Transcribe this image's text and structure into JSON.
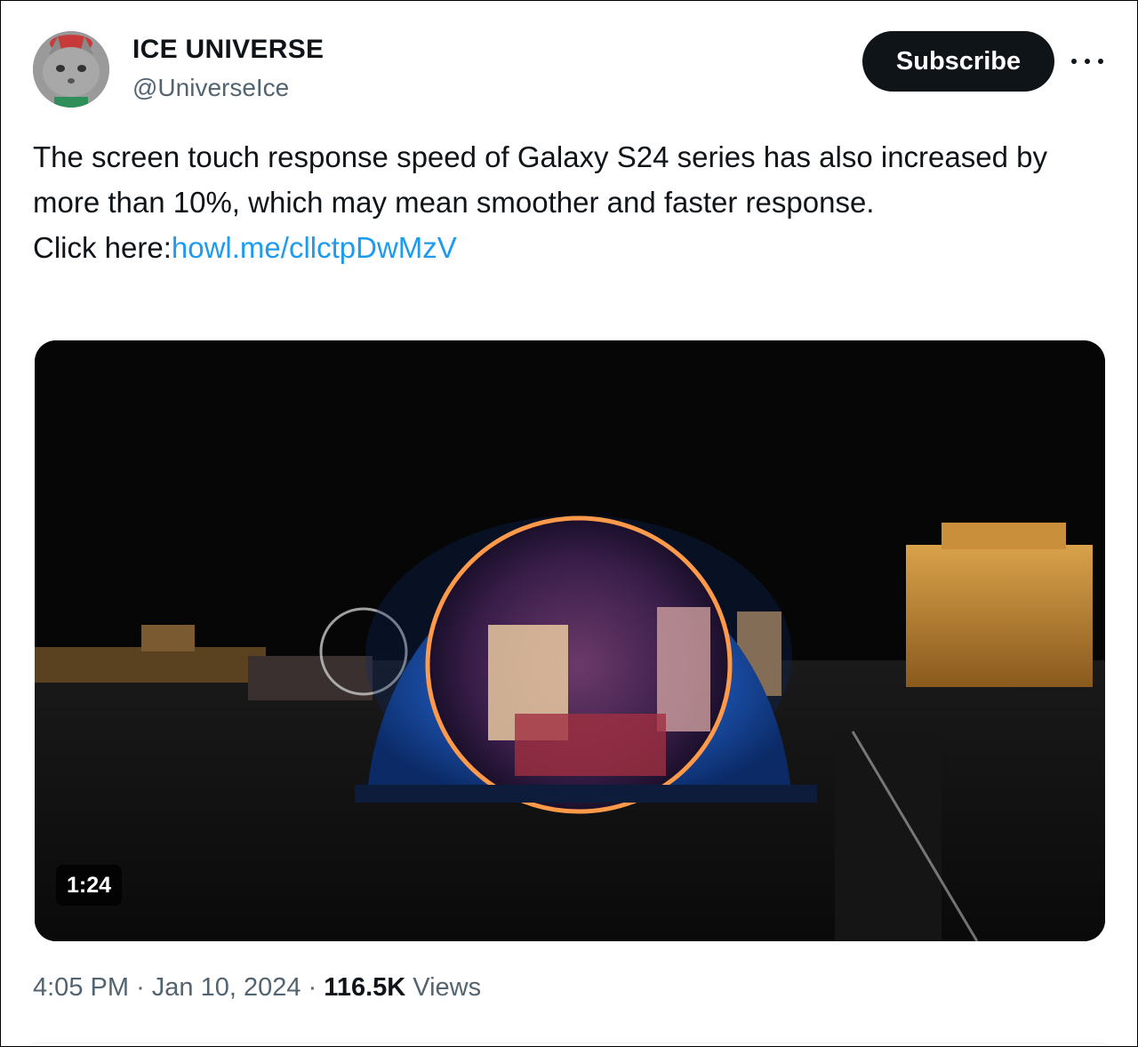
{
  "author": {
    "name": "ICE UNIVERSE",
    "handle": "@UniverseIce"
  },
  "actions": {
    "subscribe_label": "Subscribe",
    "more_icon": "more-horizontal-icon"
  },
  "tweet": {
    "text": "The screen touch response speed of Galaxy S24 series has also increased by more than 10%, which may mean smoother and faster response.",
    "link_prefix": "Click here:",
    "link_text": "howl.me/cllctpDwMzV"
  },
  "media": {
    "duration": "1:24"
  },
  "meta": {
    "time": "4:05 PM",
    "separator": "·",
    "date": "Jan 10, 2024",
    "views_count": "116.5K",
    "views_label": "Views"
  },
  "colors": {
    "accent_link": "#1d9bf0",
    "button_bg": "#0f1419",
    "secondary_text": "#536471"
  }
}
